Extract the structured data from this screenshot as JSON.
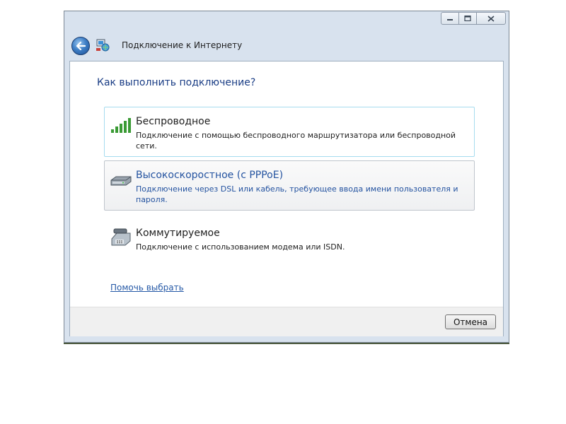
{
  "window": {
    "title": "Подключение к Интернету",
    "controls": {
      "minimize_icon": "minimize-icon",
      "maximize_icon": "maximize-icon",
      "close_icon": "close-icon"
    }
  },
  "main": {
    "heading": "Как выполнить подключение?",
    "options": [
      {
        "icon": "wireless-signal-icon",
        "title": "Беспроводное",
        "description": "Подключение с помощью беспроводного маршрутизатора или беспроводной сети."
      },
      {
        "icon": "broadband-modem-icon",
        "title": "Высокоскоростное (с PPPoE)",
        "description": "Подключение через DSL или кабель, требующее ввода имени пользователя и пароля."
      },
      {
        "icon": "dialup-phone-icon",
        "title": "Коммутируемое",
        "description": "Подключение с использованием модема или ISDN."
      }
    ],
    "help_link": "Помочь выбрать"
  },
  "footer": {
    "cancel_label": "Отмена"
  },
  "colors": {
    "heading": "#1a3d85",
    "link": "#2458a6",
    "selected_text": "#2453a0",
    "hover_border": "#a6dcef"
  }
}
